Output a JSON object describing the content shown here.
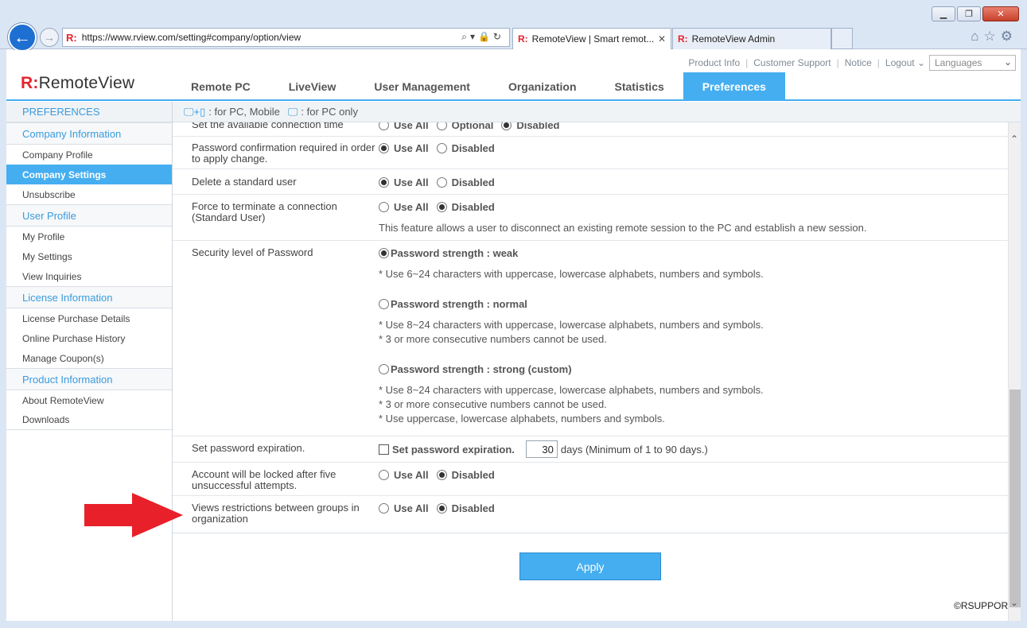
{
  "browser": {
    "url": "https://www.rview.com/setting#company/option/view",
    "tabs": [
      {
        "title": "RemoteView | Smart remot...",
        "active": true
      },
      {
        "title": "RemoteView Admin",
        "active": false
      }
    ],
    "window_buttons": {
      "minimize": "▁",
      "maximize": "❐",
      "close": "✕"
    },
    "address_icons": "⌕▾🔒↻",
    "right_icons": "⌂☆⚙"
  },
  "header": {
    "brand_prefix": "R:",
    "brand_name": "RemoteView",
    "top_links": [
      "Product Info",
      "Customer Support",
      "Notice",
      "Logout ⌄"
    ],
    "language_placeholder": "Languages",
    "nav": [
      {
        "label": "Remote PC",
        "active": false
      },
      {
        "label": "LiveView",
        "active": false
      },
      {
        "label": "User Management",
        "active": false
      },
      {
        "label": "Organization",
        "active": false
      },
      {
        "label": "Statistics",
        "active": false
      },
      {
        "label": "Preferences",
        "active": true
      }
    ]
  },
  "sidebar": {
    "title": "PREFERENCES",
    "sections": [
      {
        "label": "Company Information",
        "items": [
          {
            "label": "Company Profile",
            "active": false
          },
          {
            "label": "Company Settings",
            "active": true
          },
          {
            "label": "Unsubscribe",
            "active": false
          }
        ]
      },
      {
        "label": "User Profile",
        "items": [
          {
            "label": "My Profile",
            "active": false
          },
          {
            "label": "My Settings",
            "active": false
          },
          {
            "label": "View Inquiries",
            "active": false
          }
        ]
      },
      {
        "label": "License Information",
        "items": [
          {
            "label": "License Purchase Details",
            "active": false
          },
          {
            "label": "Online Purchase History",
            "active": false
          },
          {
            "label": "Manage Coupon(s)",
            "active": false
          }
        ]
      },
      {
        "label": "Product Information",
        "items": [
          {
            "label": "About RemoteView",
            "active": false
          },
          {
            "label": "Downloads",
            "active": false
          }
        ]
      }
    ]
  },
  "legend": {
    "pc_mobile": ": for PC, Mobile",
    "pc_only": ": for PC only"
  },
  "settings": {
    "connection_time": {
      "label": "Set the available connection time",
      "options": [
        "Use All",
        "Optional",
        "Disabled"
      ],
      "selected": "Disabled"
    },
    "password_confirm": {
      "label": "Password confirmation required in order to apply change.",
      "options": [
        "Use All",
        "Disabled"
      ],
      "selected": "Use All"
    },
    "delete_user": {
      "label": "Delete a standard user",
      "options": [
        "Use All",
        "Disabled"
      ],
      "selected": "Use All"
    },
    "force_terminate": {
      "label": "Force to terminate a connection (Standard User)",
      "options": [
        "Use All",
        "Disabled"
      ],
      "selected": "Disabled",
      "description": "This feature allows a user to disconnect an existing remote session to the PC and establish a new session."
    },
    "password_security": {
      "label": "Security level of Password",
      "levels": [
        {
          "title": "Password strength : weak",
          "selected": true,
          "notes": [
            "* Use 6~24 characters with uppercase, lowercase alphabets, numbers and symbols."
          ]
        },
        {
          "title": "Password strength : normal",
          "selected": false,
          "notes": [
            "* Use 8~24 characters with uppercase, lowercase alphabets, numbers and symbols.",
            "* 3 or more consecutive numbers cannot be used."
          ]
        },
        {
          "title": "Password strength : strong (custom)",
          "selected": false,
          "notes": [
            "* Use 8~24 characters with uppercase, lowercase alphabets, numbers and symbols.",
            "* 3 or more consecutive numbers cannot be used.",
            "* Use uppercase, lowercase alphabets, numbers and symbols."
          ]
        }
      ]
    },
    "password_expiration": {
      "label": "Set password expiration.",
      "checkbox_label": "Set password expiration.",
      "checked": false,
      "days_value": "30",
      "days_suffix": "days (Minimum of 1 to 90 days.)"
    },
    "account_lock": {
      "label": "Account will be locked after five unsuccessful attempts.",
      "options": [
        "Use All",
        "Disabled"
      ],
      "selected": "Disabled"
    },
    "views_restrictions": {
      "label": "Views restrictions between groups in organization",
      "options": [
        "Use All",
        "Disabled"
      ],
      "selected": "Disabled"
    }
  },
  "apply_label": "Apply",
  "copyright": "©RSUPPORT",
  "colors": {
    "accent": "#45aef0",
    "brand_red": "#e4232f",
    "arrow_red": "#e8202a"
  }
}
